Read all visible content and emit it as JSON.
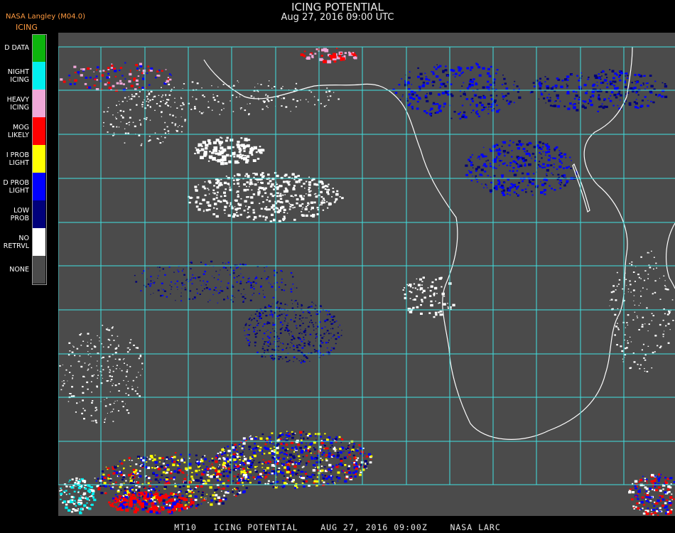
{
  "header": {
    "title": "ICING POTENTIAL",
    "subtitle": "Aug 27, 2016 09:00 UTC",
    "source": "NASA Langley (M04.0)",
    "product": "ICING"
  },
  "legend": [
    {
      "label": "D DATA",
      "color": "#0db40d"
    },
    {
      "label": "NIGHT ICING",
      "color": "#00f0f0"
    },
    {
      "label": "HEAVY ICING",
      "color": "#f0a8d8"
    },
    {
      "label": "MOG LIKELY",
      "color": "#ff0000"
    },
    {
      "label": "I PROB LIGHT",
      "color": "#ffff00"
    },
    {
      "label": "D PROB LIGHT",
      "color": "#0000ff"
    },
    {
      "label": "LOW PROB",
      "color": "#00007a"
    },
    {
      "label": "NO RETRVL",
      "color": "#ffffff"
    },
    {
      "label": "NONE",
      "color": "#4b4b4b"
    }
  ],
  "map": {
    "background": "#4b4b4b",
    "grid_color": "#40e0e0",
    "coastline_color": "#ffffff",
    "tick_label_color": "#c80000"
  },
  "footer": "MT10   ICING POTENTIAL    AUG 27, 2016 09:00Z    NASA LARC"
}
